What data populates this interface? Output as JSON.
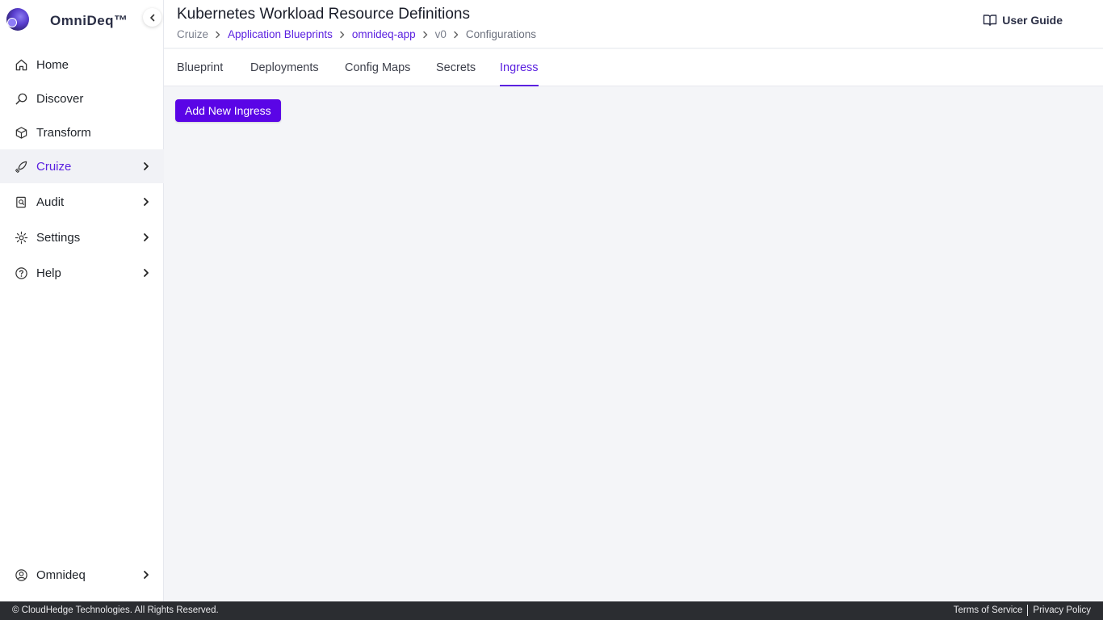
{
  "brand": {
    "name": "OmniDeq™"
  },
  "sidebar": {
    "items": [
      {
        "label": "Home",
        "icon": "home-icon"
      },
      {
        "label": "Discover",
        "icon": "search-icon"
      },
      {
        "label": "Transform",
        "icon": "cube-icon"
      },
      {
        "label": "Cruize",
        "icon": "rocket-icon",
        "active": true,
        "has_children": true
      },
      {
        "label": "Audit",
        "icon": "audit-icon",
        "has_children": true
      },
      {
        "label": "Settings",
        "icon": "gear-icon",
        "has_children": true
      },
      {
        "label": "Help",
        "icon": "help-icon",
        "has_children": true
      }
    ],
    "account": {
      "label": "Omnideq",
      "icon": "user-circle-icon",
      "has_children": true
    }
  },
  "header": {
    "title": "Kubernetes Workload Resource Definitions",
    "user_guide": "User Guide",
    "breadcrumb": [
      "Cruize",
      "Application Blueprints",
      "omnideq-app",
      "v0",
      "Configurations"
    ]
  },
  "tabs": [
    {
      "label": "Blueprint"
    },
    {
      "label": "Deployments"
    },
    {
      "label": "Config Maps"
    },
    {
      "label": "Secrets"
    },
    {
      "label": "Ingress",
      "active": true
    }
  ],
  "content": {
    "add_button": "Add New Ingress"
  },
  "footer": {
    "copyright": "© CloudHedge Technologies. All Rights Reserved.",
    "terms": "Terms of Service",
    "privacy": "Privacy Policy"
  },
  "colors": {
    "accent": "#5b21e0",
    "button": "#5a05e6",
    "footer_bg": "#2b2d31",
    "page_bg": "#f4f5f8"
  }
}
